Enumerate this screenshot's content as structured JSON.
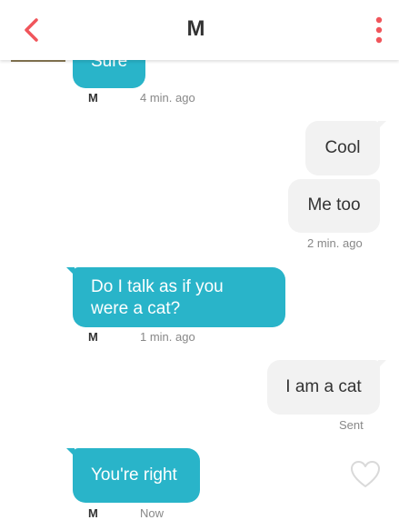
{
  "header": {
    "back_icon": "chevron-left-icon",
    "title": "M",
    "menu_icon": "vertical-dots-icon",
    "accent_color": "#f0555b"
  },
  "messages": [
    {
      "direction": "incoming",
      "text": "Sure",
      "sender": "M",
      "time": "4 min. ago"
    },
    {
      "direction": "outgoing",
      "text": "Cool"
    },
    {
      "direction": "outgoing",
      "text": "Me too",
      "time": "2 min. ago"
    },
    {
      "direction": "incoming",
      "text_lines": [
        "Do I talk as if you",
        "were a cat?"
      ],
      "sender": "M",
      "time": "1 min. ago"
    },
    {
      "direction": "outgoing",
      "text": "I am a cat",
      "status": "Sent"
    },
    {
      "direction": "incoming",
      "text": "You're right",
      "sender": "M",
      "time": "Now",
      "like_icon": "heart-outline-icon"
    }
  ],
  "colors": {
    "incoming_bubble": "#29b4c9",
    "outgoing_bubble": "#f2f2f2"
  }
}
